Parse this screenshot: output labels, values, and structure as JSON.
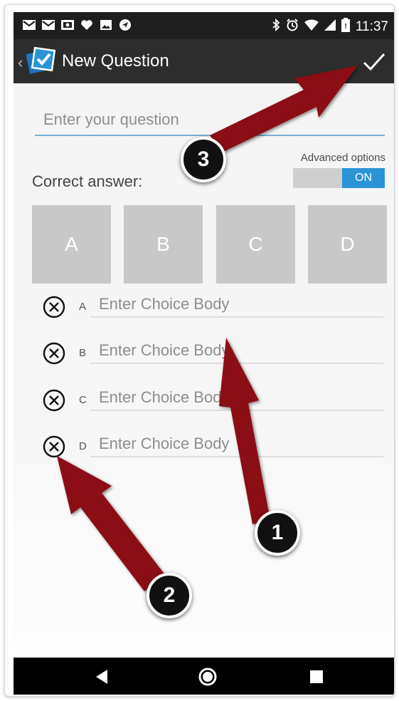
{
  "status_bar": {
    "time": "11:37",
    "left_icons": [
      "gmail-icon",
      "gmail-icon",
      "photo-icon",
      "heart-icon",
      "image-icon",
      "navigation-icon"
    ],
    "right_icons": [
      "bluetooth-icon",
      "alarm-icon",
      "wifi-icon",
      "signal-icon",
      "battery-icon"
    ]
  },
  "action_bar": {
    "back_symbol": "‹",
    "title": "New Question",
    "confirm_icon": "checkmark-icon"
  },
  "question": {
    "placeholder": "Enter your question"
  },
  "advanced_options": {
    "label": "Advanced options",
    "toggle_state": "ON"
  },
  "correct_answer": {
    "label": "Correct answer:",
    "options": [
      "A",
      "B",
      "C",
      "D"
    ]
  },
  "choices": [
    {
      "letter": "A",
      "placeholder": "Enter Choice Body"
    },
    {
      "letter": "B",
      "placeholder": "Enter Choice Body"
    },
    {
      "letter": "C",
      "placeholder": "Enter Choice Body"
    },
    {
      "letter": "D",
      "placeholder": "Enter Choice Body"
    }
  ],
  "nav_bar": {
    "icons": [
      "back-triangle-icon",
      "home-circle-icon",
      "recents-square-icon"
    ]
  },
  "callouts": [
    "1",
    "2",
    "3"
  ],
  "colors": {
    "accent": "#2a94d6",
    "arrow": "#8b0d12",
    "answer_tile": "#c8c8c8"
  }
}
